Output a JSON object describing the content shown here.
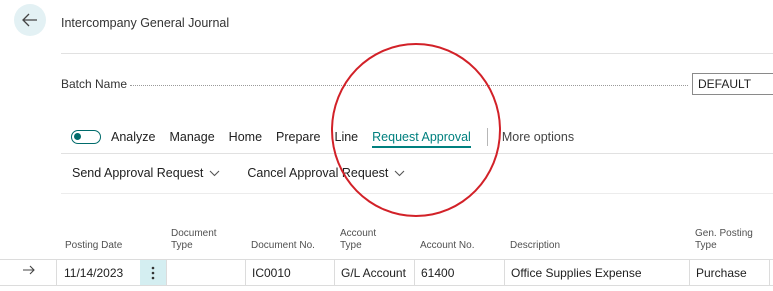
{
  "page": {
    "title": "Intercompany General Journal"
  },
  "batch": {
    "label": "Batch Name",
    "value": "DEFAULT"
  },
  "actionbar": {
    "analyze_label": "Analyze",
    "items": [
      "Manage",
      "Home",
      "Prepare",
      "Line",
      "Request Approval"
    ],
    "active_item": "Request Approval",
    "more_label": "More options"
  },
  "subactions": {
    "send": "Send Approval Request",
    "cancel": "Cancel Approval Request"
  },
  "table": {
    "headers": {
      "posting_date": "Posting Date",
      "document_type_1": "Document",
      "document_type_2": "Type",
      "document_no": "Document No.",
      "account_type_1": "Account",
      "account_type_2": "Type",
      "account_no": "Account No.",
      "description": "Description",
      "gen_posting_type_1": "Gen. Posting",
      "gen_posting_type_2": "Type"
    },
    "rows": [
      {
        "posting_date": "11/14/2023",
        "document_type": "",
        "document_no": "IC0010",
        "account_type": "G/L Account",
        "account_no": "61400",
        "description": "Office Supplies Expense",
        "gen_posting_type": "Purchase"
      }
    ]
  },
  "colors": {
    "accent": "#00807f",
    "annotation": "#d22128",
    "selected_cell": "#d4eef1"
  },
  "icons": {
    "back": "arrow-left-icon",
    "chevron": "chevron-down-icon",
    "row_indicator": "arrow-right-icon",
    "row_menu": "vertical-ellipsis-icon"
  }
}
